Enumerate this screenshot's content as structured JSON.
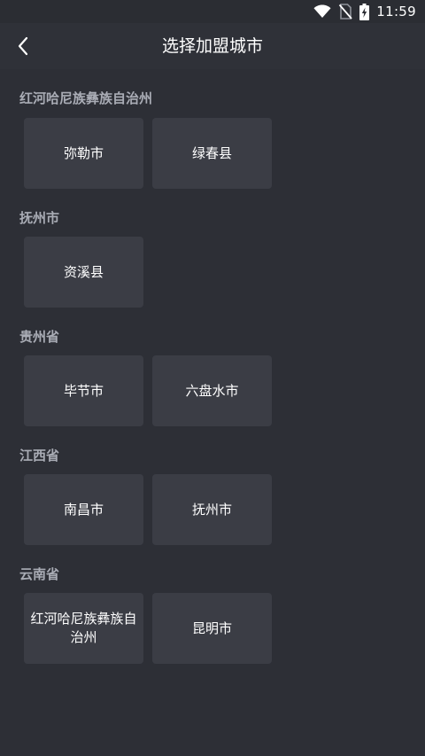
{
  "status_bar": {
    "time": "11:59",
    "icons": [
      "wifi-icon",
      "no-sim-icon",
      "battery-charging-icon"
    ]
  },
  "header": {
    "back_icon": "chevron-left-icon",
    "title": "选择加盟城市"
  },
  "colors": {
    "background": "#2d2f36",
    "header_background": "#2f3138",
    "card_background": "#3b3d45",
    "section_title": "#a9acb5",
    "text": "#ffffff"
  },
  "sections": [
    {
      "title": "红河哈尼族彝族自治州",
      "cities": [
        "弥勒市",
        "绿春县"
      ]
    },
    {
      "title": "抚州市",
      "cities": [
        "资溪县"
      ]
    },
    {
      "title": "贵州省",
      "cities": [
        "毕节市",
        "六盘水市"
      ]
    },
    {
      "title": "江西省",
      "cities": [
        "南昌市",
        "抚州市"
      ]
    },
    {
      "title": "云南省",
      "cities": [
        "红河哈尼族彝族自治州",
        "昆明市"
      ]
    }
  ]
}
